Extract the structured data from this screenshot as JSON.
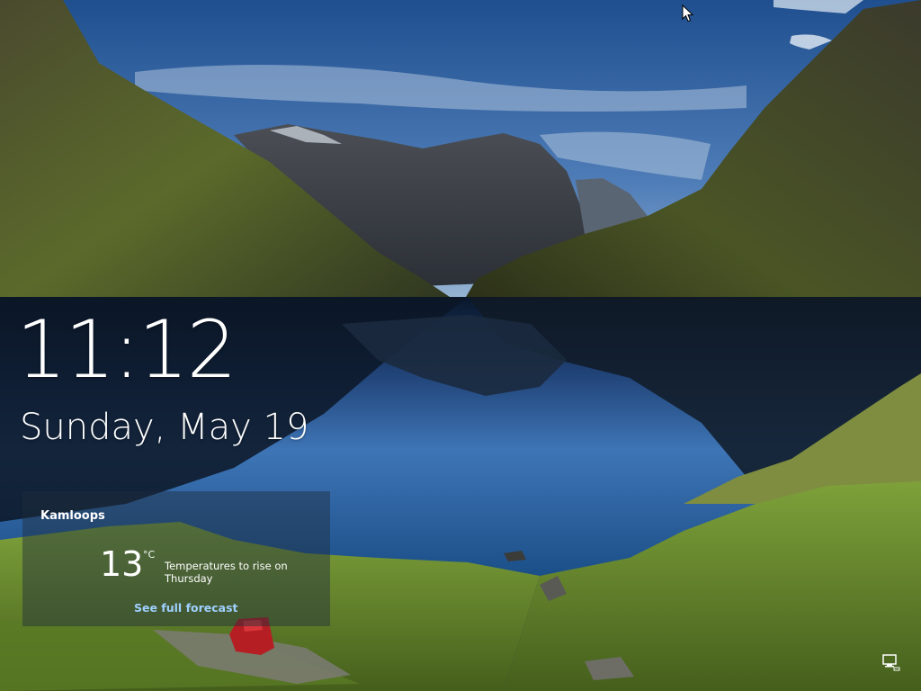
{
  "clock": {
    "time": "11:12",
    "date": "Sunday, May 19"
  },
  "weather": {
    "location": "Kamloops",
    "temperature": "13",
    "unit": "°C",
    "summary": "Temperatures to rise on Thursday",
    "forecast_link": "See full forecast"
  },
  "system_tray": {
    "network_icon": "network-icon"
  },
  "colors": {
    "sky": "#2f5f9c",
    "lake": "#1d4f8c",
    "grass": "#6c8a2c",
    "link": "#9fd0ff"
  }
}
